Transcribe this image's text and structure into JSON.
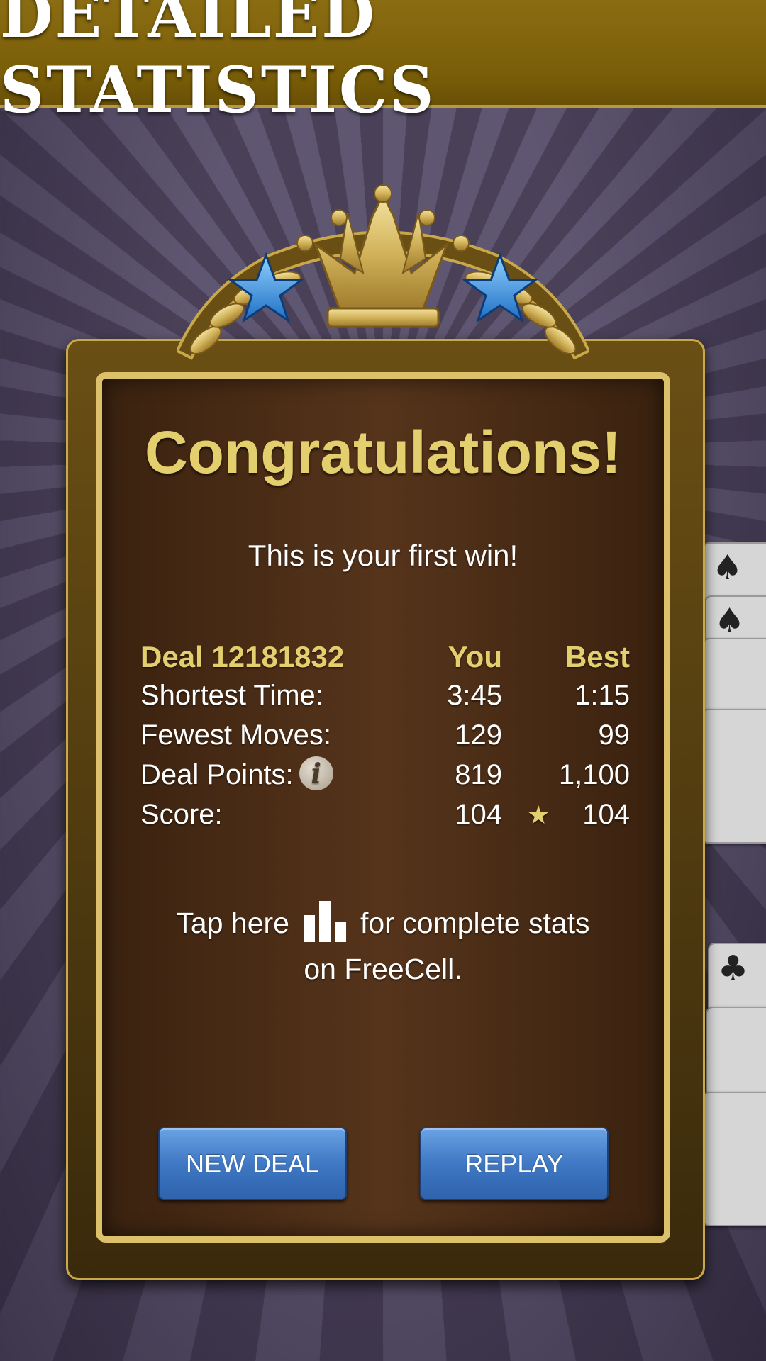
{
  "header": {
    "title": "DETAILED STATISTICS"
  },
  "dialog": {
    "title": "Congratulations!",
    "subtitle": "This is your first win!",
    "stats": {
      "deal_label": "Deal 12181832",
      "col_you": "You",
      "col_best": "Best",
      "rows": [
        {
          "label": "Shortest Time:",
          "you": "3:45",
          "best": "1:15"
        },
        {
          "label": "Fewest Moves:",
          "you": "129",
          "best": "99"
        },
        {
          "label": "Deal Points:",
          "you": "819",
          "best": "1,100"
        },
        {
          "label": "Score:",
          "you": "104",
          "best": "104"
        }
      ],
      "info_glyph": "i",
      "score_star": "★"
    },
    "tap_text_before": "Tap here",
    "tap_text_after": "for complete stats",
    "tap_text_line2": "on FreeCell.",
    "buttons": {
      "new_deal": "NEW DEAL",
      "replay": "REPLAY"
    }
  },
  "background_cards": [
    "♠",
    "♠",
    "♣"
  ],
  "icons": {
    "info": "info-icon",
    "stats": "bar-chart-icon",
    "crown": "crown-icon",
    "star": "star-icon"
  },
  "colors": {
    "banner": "#7a5e08",
    "gold": "#e3cf6e",
    "button": "#3f78c4",
    "panel": "#56341b"
  }
}
